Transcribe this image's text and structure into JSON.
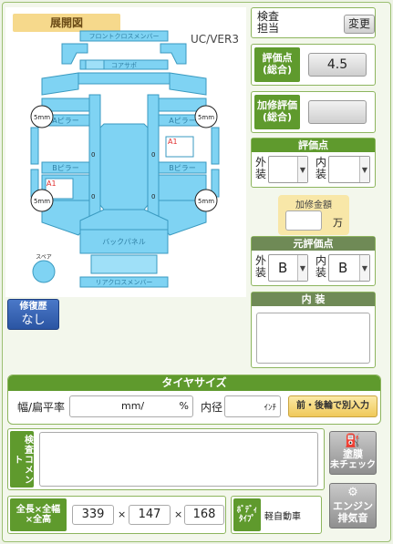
{
  "diagram": {
    "title": "展開図",
    "version": "UC/VER3",
    "parts": {
      "front_cross_member": "フロントクロスメンバー",
      "core_support": "コアサポ",
      "a_pillar_left": "Aピラー",
      "a_pillar_right": "Aピラー",
      "b_pillar_left": "Bピラー",
      "b_pillar_right": "Bピラー",
      "back_panel": "バックパネル",
      "rear_cross_member": "リアクロスメンバー",
      "spare": "スペア",
      "zero": "0"
    },
    "markers": {
      "mm_5": "5mm",
      "a1": "A1"
    }
  },
  "repair_history": {
    "line1": "修復歴",
    "line2": "なし"
  },
  "inspector": {
    "label_line1": "検査",
    "label_line2": "担当",
    "change_button": "変更"
  },
  "score": {
    "label_line1": "評価点",
    "label_line2": "(総合)",
    "value": "4.5"
  },
  "repair_score": {
    "label_line1": "加修評価",
    "label_line2": "(総合)",
    "value": ""
  },
  "rating": {
    "header": "評価点",
    "exterior_1": "外",
    "exterior_2": "装",
    "interior_1": "内",
    "interior_2": "装",
    "exterior_value": "",
    "interior_value": ""
  },
  "repair_amount": {
    "label": "加修金額",
    "unit": "万",
    "value": ""
  },
  "original_rating": {
    "header": "元評価点",
    "exterior_1": "外",
    "exterior_2": "装",
    "interior_1": "内",
    "interior_2": "装",
    "exterior_value": "B",
    "interior_value": "B"
  },
  "interior": {
    "header": "内 装",
    "text": ""
  },
  "tire": {
    "header": "タイヤサイズ",
    "width_label": "幅/扁平率",
    "width_unit": "mm/",
    "ratio_unit": "%",
    "diameter_label": "内径",
    "diameter_unit": "ｲﾝﾁ",
    "separate_button": "前・後輪で別入力"
  },
  "comment": {
    "label": "検査コメント",
    "text": ""
  },
  "dimensions": {
    "label_line1": "全長×全幅",
    "label_line2": "×全高",
    "length": "339",
    "width": "147",
    "height": "168",
    "times": "×"
  },
  "body_type": {
    "label_line1": "ﾎﾞﾃﾞｨ",
    "label_line2": "ﾀｲﾌﾟ",
    "value": "軽自動車"
  },
  "buttons": {
    "paint_line1": "塗膜",
    "paint_line2": "未チェック",
    "engine_line1": "エンジン",
    "engine_line2": "排気音"
  },
  "colors": {
    "green": "#5f9a2d",
    "panel_blue": "#7fd3f3",
    "title_gold": "#f6d98c",
    "marker_red": "#e03030"
  }
}
